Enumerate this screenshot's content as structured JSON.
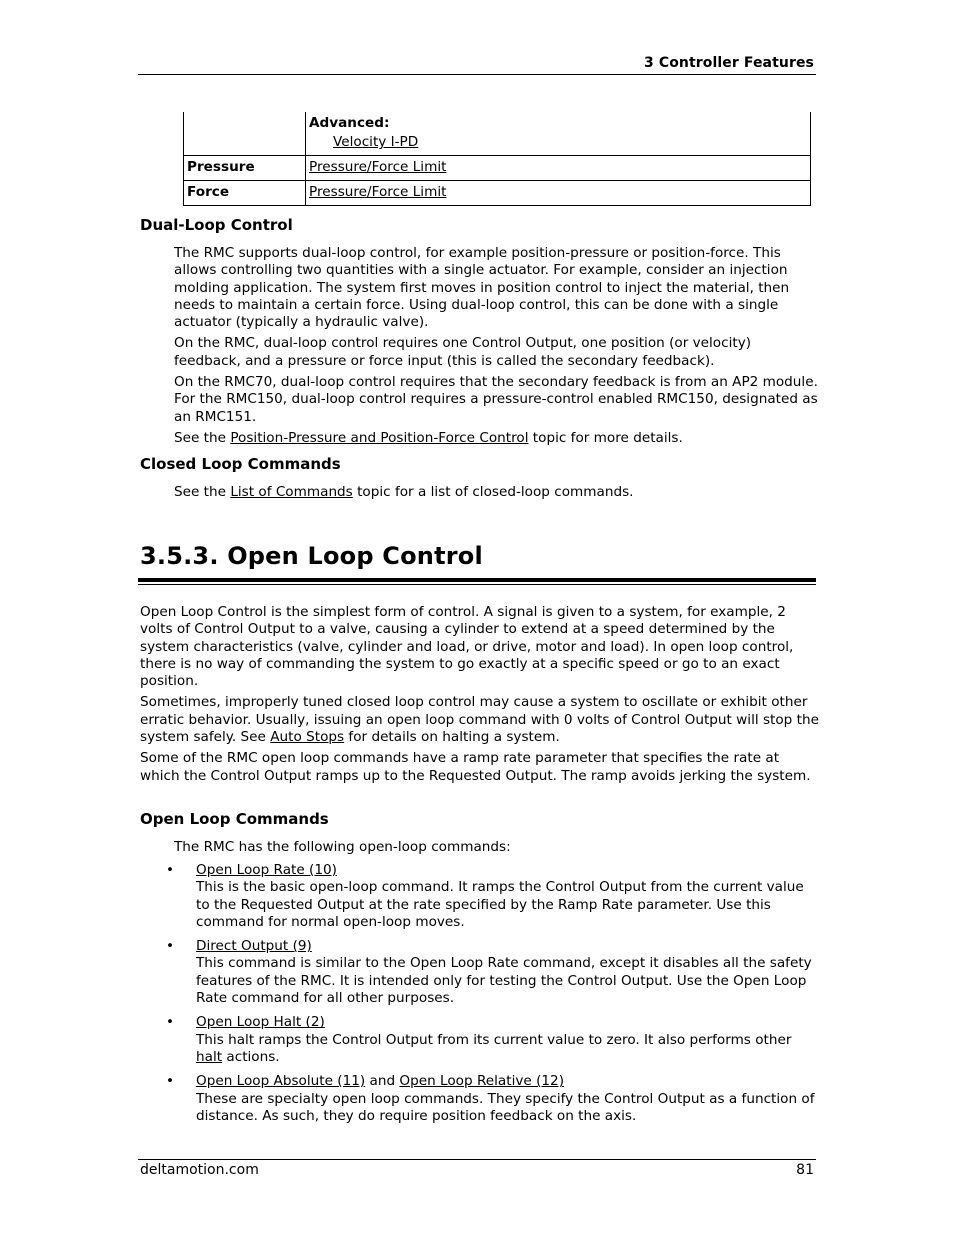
{
  "header": {
    "chapter_title": "3  Controller Features"
  },
  "feature_table": {
    "rows": [
      {
        "label": "",
        "advanced_label": "Advanced:",
        "links": [
          "Velocity I-PD"
        ]
      },
      {
        "label": "Pressure",
        "links": [
          "Pressure/Force Limit"
        ]
      },
      {
        "label": "Force",
        "links": [
          "Pressure/Force Limit"
        ]
      }
    ]
  },
  "dual_loop": {
    "heading": "Dual-Loop Control",
    "p1": "The RMC supports dual-loop control, for example position-pressure or position-force. This allows controlling two quantities with a single actuator. For example, consider an injection molding application. The system first moves in position control to inject the material, then needs to maintain a certain force. Using dual-loop control, this can be done with a single actuator (typically a hydraulic valve).",
    "p2": "On the RMC, dual-loop control requires one Control Output, one position (or velocity) feedback, and a pressure or force input (this is called the secondary feedback).",
    "p3": "On the RMC70, dual-loop control requires that the secondary feedback is from an AP2 module. For the RMC150, dual-loop control requires a pressure-control enabled RMC150, designated as an RMC151.",
    "p4_prefix": "See the ",
    "p4_link": "Position-Pressure and Position-Force Control",
    "p4_suffix": " topic for more details."
  },
  "closed_loop": {
    "heading": "Closed Loop Commands",
    "prefix": "See the ",
    "link": "List of Commands",
    "suffix": " topic for a list of closed-loop commands."
  },
  "open_loop": {
    "heading": "3.5.3. Open Loop Control",
    "p1": "Open Loop Control is the simplest form of control. A signal is given to a system, for example, 2 volts of Control Output to a valve, causing a cylinder to extend at a speed determined by the system characteristics (valve, cylinder and load, or drive, motor and load). In open loop control, there is no way of commanding the system to go exactly at a specific speed or go to an exact position.",
    "p2_prefix": "Sometimes, improperly tuned closed loop control may cause a system to oscillate or exhibit other erratic behavior. Usually, issuing an open loop command with 0 volts of Control Output will stop the system safely. See ",
    "p2_link": "Auto Stops",
    "p2_suffix": " for details on halting a system.",
    "p3": "Some of the RMC open loop commands have a ramp rate parameter that specifies the rate at which the Control Output ramps up to the Requested Output. The ramp avoids jerking the system."
  },
  "open_loop_commands": {
    "heading": "Open Loop Commands",
    "intro": "The RMC has the following open-loop commands:",
    "bullet_glyph": "•",
    "items": [
      {
        "link": "Open Loop Rate (10)",
        "desc": "This is the basic open-loop command. It ramps the Control Output from the current value to the Requested Output at the rate specified by the Ramp Rate parameter. Use this command for normal open-loop moves."
      },
      {
        "link": "Direct Output (9)",
        "desc": "This command is similar to the Open Loop Rate command, except it disables all the safety features of the RMC. It is intended only for testing the Control Output. Use the Open Loop Rate command for all other purposes."
      },
      {
        "link": "Open Loop Halt (2)",
        "desc_prefix": "This halt ramps the Control Output from its current value to zero. It also performs other ",
        "desc_link": "halt",
        "desc_suffix": " actions."
      },
      {
        "link": "Open Loop Absolute (11)",
        "joiner": " and ",
        "link2": "Open Loop Relative (12)",
        "desc": "These are specialty open loop commands. They specify the Control Output as a function of distance. As such, they do require position feedback on the axis."
      }
    ]
  },
  "footer": {
    "site": "deltamotion.com",
    "page_number": "81"
  }
}
